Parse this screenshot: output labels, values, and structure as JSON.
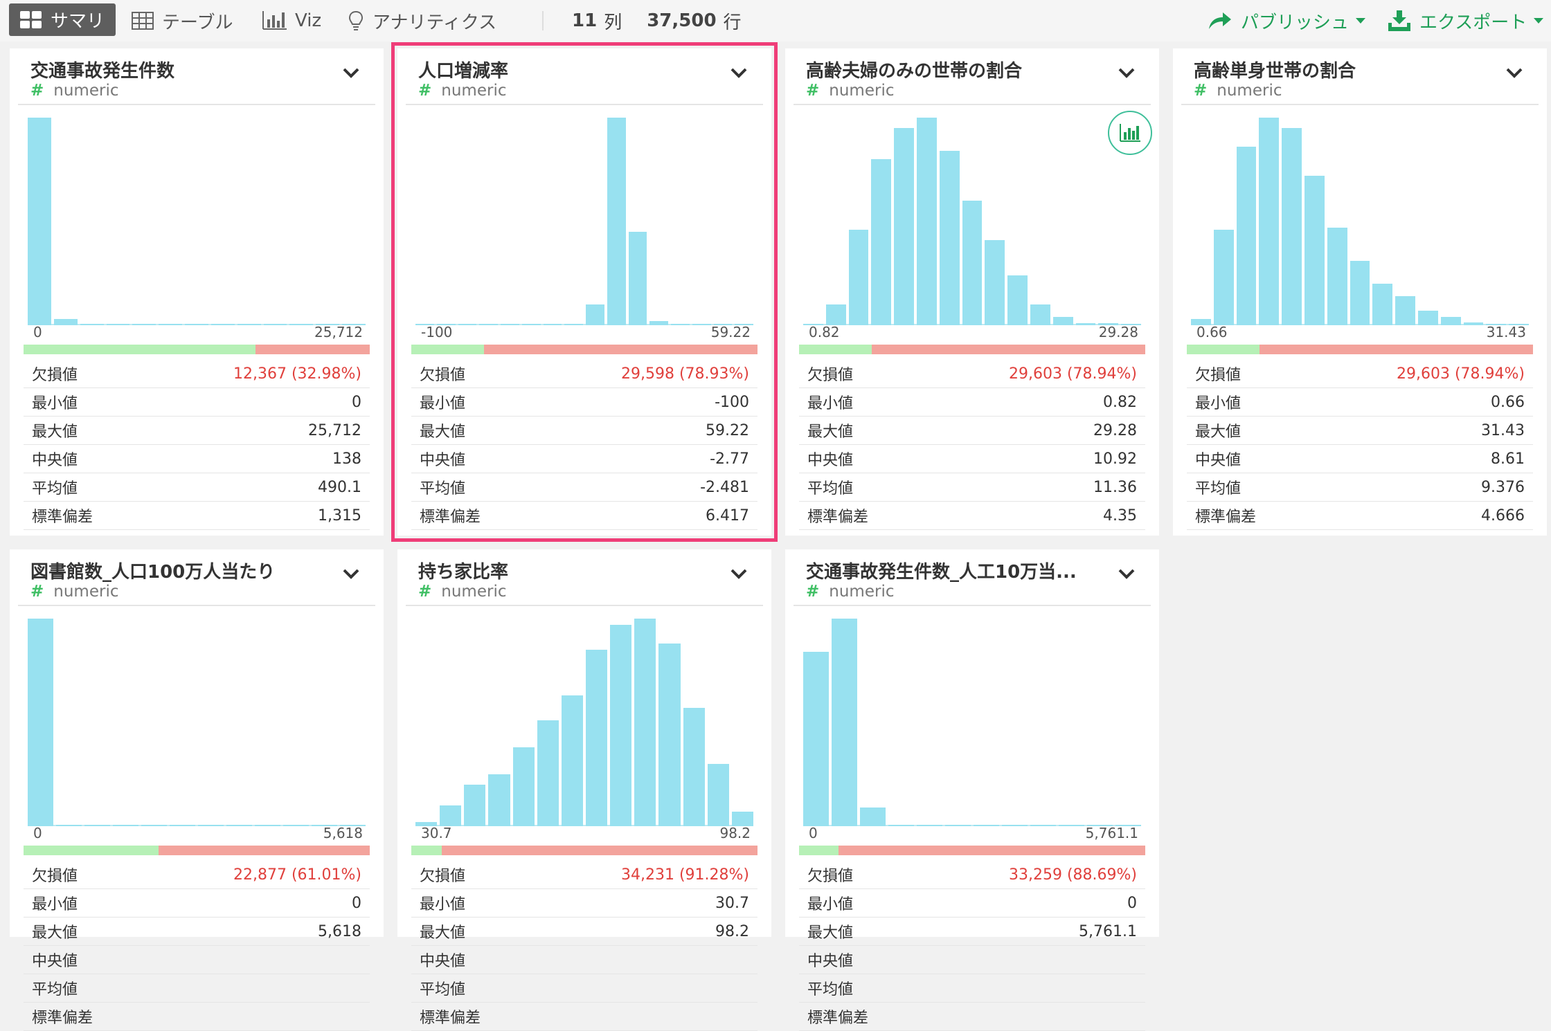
{
  "toolbar": {
    "tabs": [
      {
        "label": "サマリ",
        "icon": "grid-icon",
        "active": true
      },
      {
        "label": "テーブル",
        "icon": "table-icon"
      },
      {
        "label": "Viz",
        "icon": "bar-chart-icon"
      },
      {
        "label": "アナリティクス",
        "icon": "lightbulb-icon"
      }
    ],
    "columns_count": "11",
    "columns_unit": "列",
    "rows_count": "37,500",
    "rows_unit": "行",
    "publish_label": "パブリッシュ",
    "export_label": "エクスポート"
  },
  "colors": {
    "accent_green": "#1f9f57",
    "bar": "#98e1f0",
    "selected_outline": "#ef3d78",
    "missing": "#f3a39c",
    "present": "#b6f0b6"
  },
  "stat_labels": [
    "欠損値",
    "最小値",
    "最大値",
    "中央値",
    "平均値",
    "標準偏差"
  ],
  "cards": [
    {
      "title": "交通事故発生件数",
      "type": "numeric",
      "hist": [
        1.0,
        0.03,
        0.005,
        0.003,
        0.003,
        0.002,
        0.002,
        0.002,
        0.002,
        0.002,
        0.002,
        0.002,
        0.002
      ],
      "x_min": "0",
      "x_max": "25,712",
      "present_ratio": 0.6702,
      "stats": [
        "12,367 (32.98%)",
        "0",
        "25,712",
        "138",
        "490.1",
        "1,315"
      ]
    },
    {
      "title": "人口増減率",
      "type": "numeric",
      "selected": true,
      "hist": [
        0.004,
        0.004,
        0.004,
        0.004,
        0.004,
        0.004,
        0.004,
        0.004,
        0.1,
        1.0,
        0.45,
        0.02,
        0.004,
        0.004,
        0.004,
        0.004
      ],
      "x_min": "-100",
      "x_max": "59.22",
      "present_ratio": 0.2107,
      "stats": [
        "29,598 (78.93%)",
        "-100",
        "59.22",
        "-2.77",
        "-2.481",
        "6.417"
      ]
    },
    {
      "title": "高齢夫婦のみの世帯の割合",
      "type": "numeric",
      "chart_button": true,
      "hist": [
        0.005,
        0.1,
        0.46,
        0.8,
        0.95,
        1.0,
        0.84,
        0.6,
        0.41,
        0.24,
        0.1,
        0.04,
        0.01,
        0.01,
        0.005
      ],
      "x_min": "0.82",
      "x_max": "29.28",
      "present_ratio": 0.2106,
      "stats": [
        "29,603 (78.94%)",
        "0.82",
        "29.28",
        "10.92",
        "11.36",
        "4.35"
      ]
    },
    {
      "title": "高齢単身世帯の割合",
      "type": "numeric",
      "hist": [
        0.03,
        0.46,
        0.86,
        1.0,
        0.95,
        0.72,
        0.47,
        0.31,
        0.2,
        0.14,
        0.07,
        0.04,
        0.015,
        0.005,
        0.005
      ],
      "x_min": "0.66",
      "x_max": "31.43",
      "present_ratio": 0.2106,
      "stats": [
        "29,603 (78.94%)",
        "0.66",
        "31.43",
        "8.61",
        "9.376",
        "4.666"
      ]
    },
    {
      "title": "図書館数_人口100万人当たり",
      "type": "numeric",
      "hist": [
        1.0,
        0.005,
        0.003,
        0.003,
        0.003,
        0.003,
        0.003,
        0.003,
        0.003,
        0.003,
        0.003,
        0.003
      ],
      "x_min": "0",
      "x_max": "5,618",
      "present_ratio": 0.3899,
      "stats": [
        "22,877 (61.01%)",
        "0",
        "5,618",
        "",
        "",
        ""
      ]
    },
    {
      "title": "持ち家比率",
      "type": "numeric",
      "hist": [
        0.02,
        0.1,
        0.2,
        0.25,
        0.38,
        0.51,
        0.63,
        0.85,
        0.97,
        1.0,
        0.88,
        0.57,
        0.3,
        0.07
      ],
      "x_min": "30.7",
      "x_max": "98.2",
      "present_ratio": 0.0872,
      "stats": [
        "34,231 (91.28%)",
        "30.7",
        "98.2",
        "",
        "",
        ""
      ]
    },
    {
      "title": "交通事故発生件数_人工10万当...",
      "type": "numeric",
      "hist": [
        0.84,
        1.0,
        0.09,
        0.005,
        0.005,
        0.005,
        0.005,
        0.005,
        0.005,
        0.005,
        0.005,
        0.005
      ],
      "x_min": "0",
      "x_max": "5,761.1",
      "present_ratio": 0.1131,
      "stats": [
        "33,259 (88.69%)",
        "0",
        "5,761.1",
        "",
        "",
        ""
      ]
    }
  ]
}
